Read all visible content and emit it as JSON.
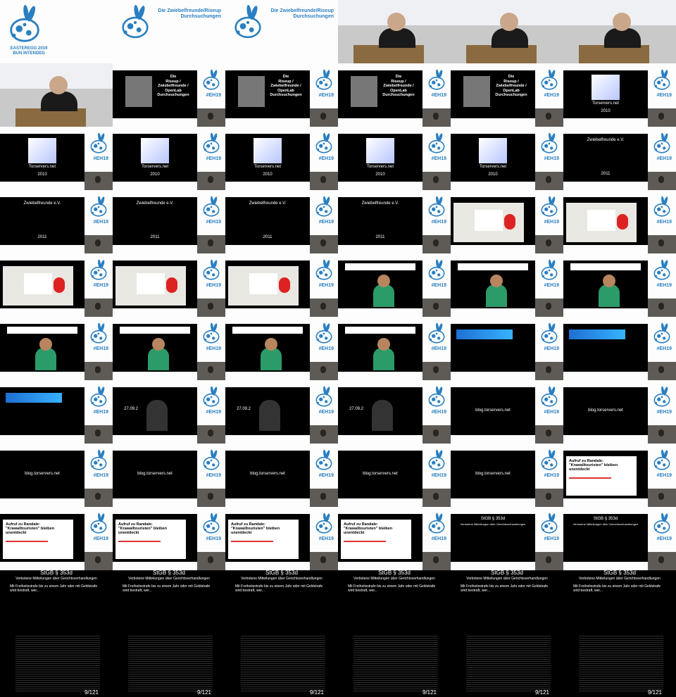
{
  "talk": {
    "event": "EASTEREGG 2019",
    "motto": "BUN INTENDED",
    "title_line1": "Die Zwiebelfreunde/Riseup",
    "title_line2": "Durchsuchungen",
    "hashtag": "#EH19"
  },
  "slides": {
    "title": [
      "Die",
      "Riseup /",
      "Zwiebelfreunde /",
      "OpenLab",
      "Durchsuchungen"
    ],
    "torservers": "Torservers.net",
    "year2010": "2010",
    "zwiebel": "Zwiebelfreunde e.V.",
    "year2011": "2011",
    "blog": "blog.torservers.net",
    "article": "Aufruf zu Randale: \"Krawalltouristen\" bleiben unentdeckt",
    "date": "27.09.2",
    "stgb_title": "StGB § 353d",
    "stgb_sub": "Verbotene Mitteilungen über Gerichtsverhandlungen",
    "stgb_line": "Mit Freiheitsstrafe bis zu einem Jahr oder mit Geldstrafe wird bestraft, wer...",
    "page": "9/121"
  },
  "colors": {
    "accent": "#2a7fc0",
    "slide_bg": "#000000",
    "red": "#dd3333"
  }
}
